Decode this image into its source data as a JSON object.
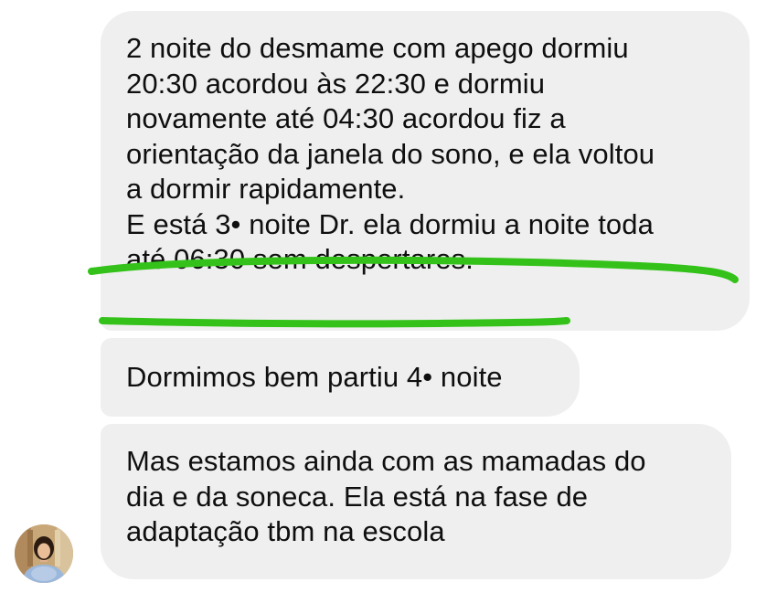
{
  "messages": [
    {
      "lines": [
        "2 noite do desmame com apego dormiu",
        "20:30 acordou às 22:30 e dormiu",
        "novamente até 04:30 acordou fiz a",
        "orientação da janela do sono, e ela voltou",
        "a dormir rapidamente.",
        "E está 3• noite Dr. ela dormiu a noite toda",
        "até 06:30 sem despertares."
      ]
    },
    {
      "lines": [
        "Dormimos bem partiu 4• noite"
      ]
    },
    {
      "lines": [
        "Mas estamos ainda com as mamadas do",
        "dia e da soneca. Ela está na fase de",
        "adaptação tbm na escola"
      ]
    }
  ],
  "colors": {
    "bubble_background": "#efefef",
    "highlight_stroke": "#34c21a",
    "text": "#0f0f0f"
  },
  "icons": {
    "avatar": "sender-avatar-photo"
  }
}
